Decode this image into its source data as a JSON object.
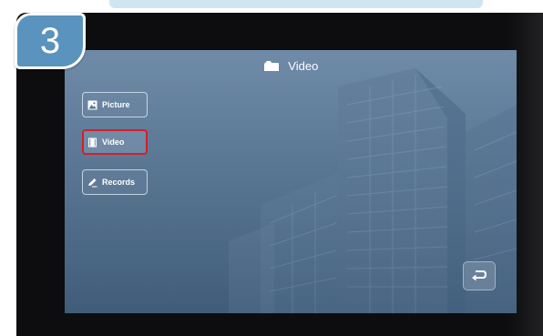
{
  "step": {
    "number": "3"
  },
  "screen": {
    "title": "Video",
    "title_icon": "folder-icon"
  },
  "menu": {
    "items": [
      {
        "label": "Picture",
        "icon": "picture-icon",
        "selected": false
      },
      {
        "label": "Video",
        "icon": "video-file-icon",
        "selected": true
      },
      {
        "label": "Records",
        "icon": "pen-icon",
        "selected": false
      }
    ]
  },
  "back_button": {
    "icon": "return-arrow-icon"
  },
  "colors": {
    "badge": "#5a93bd",
    "selection_outline": "#d21f2b",
    "screen_top": "#6f8ba8",
    "screen_bottom": "#415d7a",
    "bezel": "#0d0d0f"
  }
}
